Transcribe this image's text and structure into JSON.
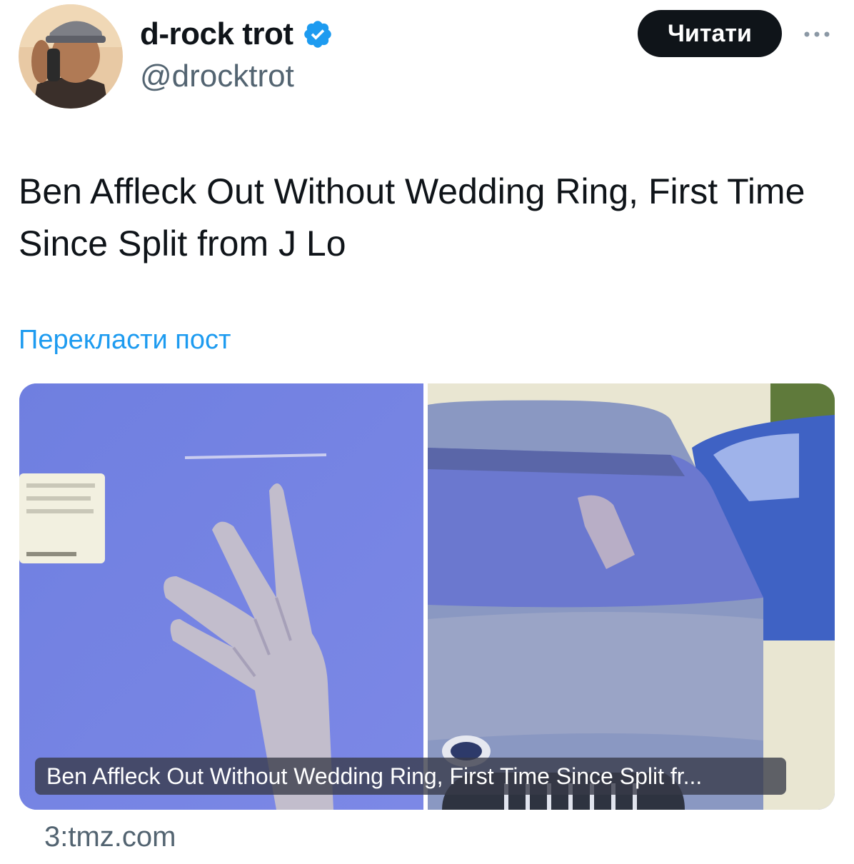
{
  "author": {
    "display_name": "d-rock trot",
    "handle": "@drocktrot",
    "verified": true,
    "verified_color": "#1d9bf0"
  },
  "actions": {
    "follow_label": "Читати",
    "more_icon": "ellipsis-icon"
  },
  "post": {
    "text": "Ben Affleck Out Without Wedding Ring, First Time Since Split from J Lo",
    "translate_label": "Перекласти пост"
  },
  "card": {
    "title": "Ben Affleck Out Without Wedding Ring, First Time Since Split fr...",
    "source": "3:tmz.com"
  },
  "colors": {
    "text_primary": "#0f1419",
    "text_secondary": "#536471",
    "link": "#1d9bf0",
    "button_bg": "#0f1419",
    "button_text": "#ffffff"
  }
}
